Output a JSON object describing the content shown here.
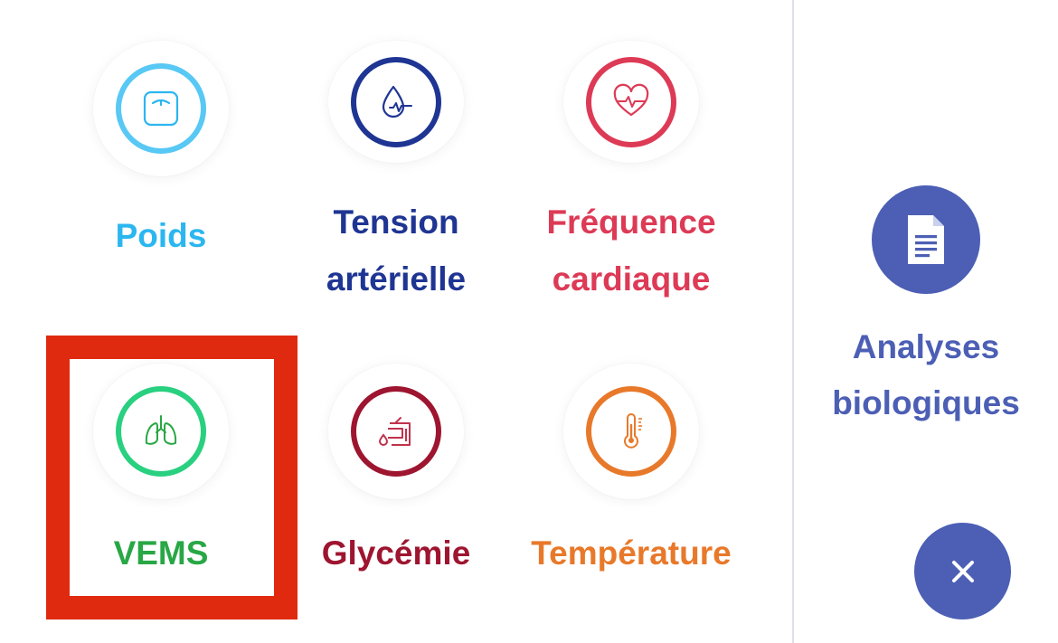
{
  "measures": [
    {
      "label": "Poids",
      "icon": "scale-icon",
      "color": "#2bb6f0",
      "ring_color": "#58c8f5"
    },
    {
      "label": "Tension\nartérielle",
      "icon": "blood-pressure-drop-icon",
      "color": "#1f3593",
      "ring_color": "#1f3593"
    },
    {
      "label": "Fréquence\ncardiaque",
      "icon": "heart-rate-icon",
      "color": "#dd3a56",
      "ring_color": "#dd3a56"
    },
    {
      "label": "VEMS",
      "icon": "lungs-icon",
      "color": "#28a745",
      "ring_color": "#28d07f"
    },
    {
      "label": "Glycémie",
      "icon": "glucose-icon",
      "color": "#9e1530",
      "ring_color": "#9e1530"
    },
    {
      "label": "Température",
      "icon": "thermometer-icon",
      "color": "#e8792a",
      "ring_color": "#e8792a"
    }
  ],
  "analyses": {
    "label": "Analyses\nbiologiques",
    "icon": "document-icon",
    "color": "#4c5fb5"
  },
  "close": {
    "icon": "close-icon",
    "color": "#4c5fb5"
  },
  "highlight_color": "#e02a0f"
}
